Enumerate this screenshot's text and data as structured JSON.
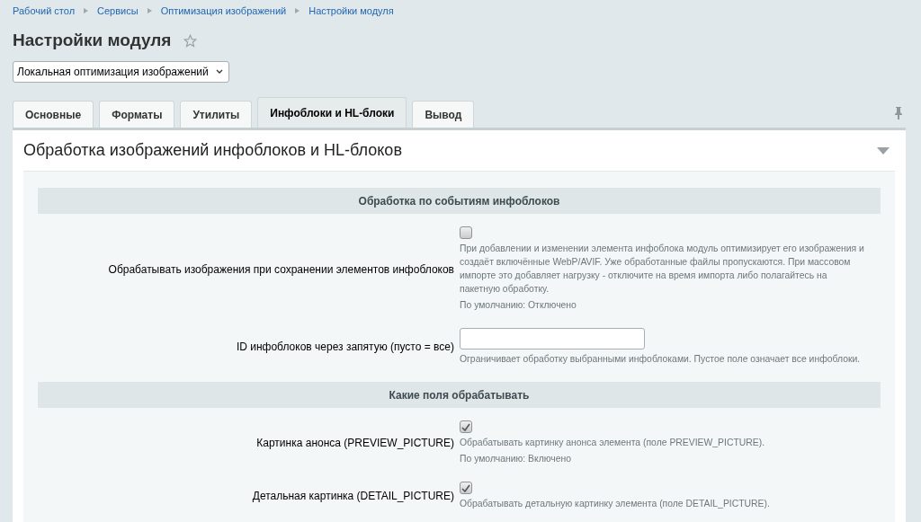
{
  "breadcrumbs": [
    "Рабочий стол",
    "Сервисы",
    "Оптимизация изображений",
    "Настройки модуля"
  ],
  "title": "Настройки модуля",
  "favorite": false,
  "module_select": {
    "value": "Локальная оптимизация изображений"
  },
  "tabs": [
    {
      "label": "Основные",
      "selected": false
    },
    {
      "label": "Форматы",
      "selected": false
    },
    {
      "label": "Утилиты",
      "selected": false
    },
    {
      "label": "Инфоблоки и HL-блоки",
      "selected": true
    },
    {
      "label": "Вывод",
      "selected": false
    }
  ],
  "panel": {
    "title": "Обработка изображений инфоблоков и HL-блоков",
    "expanded": true,
    "sections": [
      {
        "title": "Обработка по событиям инфоблоков",
        "rows": [
          {
            "kind": "checkbox",
            "label": "Обрабатывать изображения при сохранении элементов инфоблоков",
            "checked": false,
            "hint": "При добавлении и изменении элемента инфоблока модуль оптимизирует его изображения и создаёт включённые WebP/AVIF. Уже обработанные файлы пропускаются. При массовом импорте это добавляет нагрузку - отключите на время импорта либо полагайтесь на пакетную обработку.",
            "default": "По умолчанию: Отключено"
          },
          {
            "kind": "text",
            "label": "ID инфоблоков через запятую (пусто = все)",
            "hint": "Ограничивает обработку выбранными инфоблоками. Пустое поле означает все инфоблоки."
          }
        ]
      },
      {
        "title": "Какие поля обрабатывать",
        "rows": [
          {
            "kind": "checkbox",
            "label": "Картинка анонса (PREVIEW_PICTURE)",
            "checked": true,
            "hint": "Обрабатывать картинку анонса элемента (поле PREVIEW_PICTURE).",
            "default": "По умолчанию: Включено"
          },
          {
            "kind": "checkbox",
            "label": "Детальная картинка (DETAIL_PICTURE)",
            "checked": true,
            "hint": "Обрабатывать детальную картинку элемента (поле DETAIL_PICTURE)."
          }
        ]
      }
    ]
  }
}
